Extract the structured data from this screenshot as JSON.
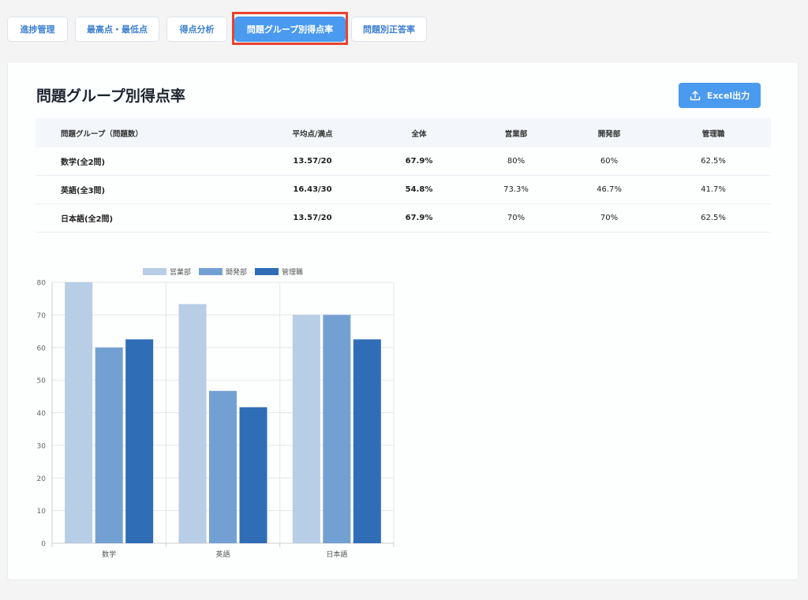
{
  "tabs": [
    {
      "label": "進捗管理",
      "active": false
    },
    {
      "label": "最高点・最低点",
      "active": false
    },
    {
      "label": "得点分析",
      "active": false
    },
    {
      "label": "問題グループ別得点率",
      "active": true
    },
    {
      "label": "問題別正答率",
      "active": false
    }
  ],
  "page": {
    "title": "問題グループ別得点率",
    "excel_button": "Excel出力"
  },
  "table": {
    "headers": [
      "問題グループ（問題数）",
      "平均点/満点",
      "全体",
      "営業部",
      "開発部",
      "管理職"
    ],
    "rows": [
      [
        "数学(全2問)",
        "13.57/20",
        "67.9%",
        "80%",
        "60%",
        "62.5%"
      ],
      [
        "英語(全3問)",
        "16.43/30",
        "54.8%",
        "73.3%",
        "46.7%",
        "41.7%"
      ],
      [
        "日本語(全2問)",
        "13.57/20",
        "67.9%",
        "70%",
        "70%",
        "62.5%"
      ]
    ]
  },
  "colors": {
    "accent": "#4a9af0",
    "highlight": "#e8432e"
  },
  "chart_data": {
    "type": "bar",
    "categories": [
      "数学",
      "英語",
      "日本語"
    ],
    "series": [
      {
        "name": "営業部",
        "values": [
          80,
          73.3,
          70
        ],
        "color": "#b8cde6"
      },
      {
        "name": "開発部",
        "values": [
          60,
          46.7,
          70
        ],
        "color": "#73a0d2"
      },
      {
        "name": "管理職",
        "values": [
          62.5,
          41.7,
          62.5
        ],
        "color": "#2f6db7"
      }
    ],
    "ylim": [
      0,
      80
    ],
    "yticks": [
      0,
      10,
      20,
      30,
      40,
      50,
      60,
      70,
      80
    ],
    "grid": true,
    "legend": "top-center"
  }
}
